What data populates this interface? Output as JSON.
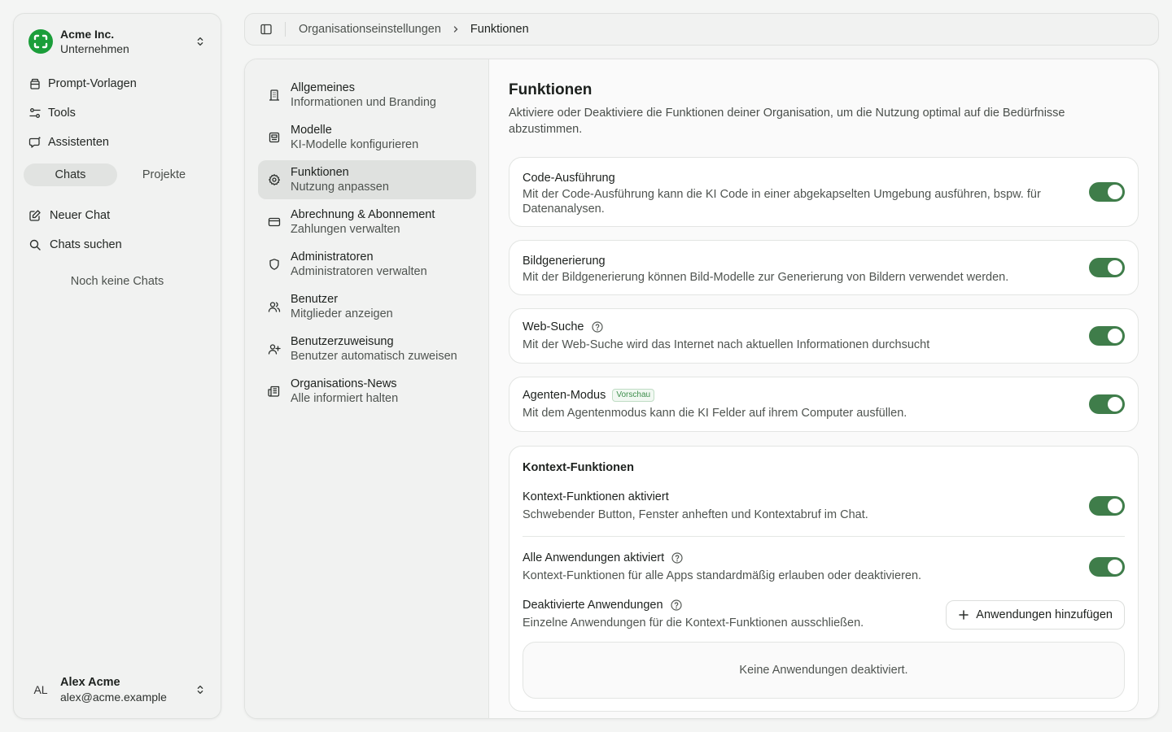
{
  "sidebar": {
    "org": {
      "name": "Acme Inc.",
      "subtitle": "Unternehmen"
    },
    "nav": [
      {
        "label": "Prompt-Vorlagen",
        "icon": "prompt-template-icon"
      },
      {
        "label": "Tools",
        "icon": "tools-icon"
      },
      {
        "label": "Assistenten",
        "icon": "assistant-icon"
      }
    ],
    "tabs": [
      {
        "label": "Chats",
        "active": true
      },
      {
        "label": "Projekte",
        "active": false
      }
    ],
    "actions": [
      {
        "label": "Neuer Chat",
        "icon": "edit-icon"
      },
      {
        "label": "Chats suchen",
        "icon": "search-icon"
      }
    ],
    "empty_text": "Noch keine Chats",
    "user": {
      "initials": "AL",
      "name": "Alex Acme",
      "email": "alex@acme.example"
    }
  },
  "breadcrumb": {
    "parent": "Organisationseinstellungen",
    "current": "Funktionen"
  },
  "settings_nav": [
    {
      "title": "Allgemeines",
      "subtitle": "Informationen und Branding",
      "icon": "building-icon"
    },
    {
      "title": "Modelle",
      "subtitle": "KI-Modelle konfigurieren",
      "icon": "model-icon"
    },
    {
      "title": "Funktionen",
      "subtitle": "Nutzung anpassen",
      "icon": "gear-icon",
      "active": true
    },
    {
      "title": "Abrechnung & Abonnement",
      "subtitle": "Zahlungen verwalten",
      "icon": "credit-card-icon"
    },
    {
      "title": "Administratoren",
      "subtitle": "Administratoren verwalten",
      "icon": "shield-icon"
    },
    {
      "title": "Benutzer",
      "subtitle": "Mitglieder anzeigen",
      "icon": "users-icon"
    },
    {
      "title": "Benutzerzuweisung",
      "subtitle": "Benutzer automatisch zuweisen",
      "icon": "user-plus-icon"
    },
    {
      "title": "Organisations-News",
      "subtitle": "Alle informiert halten",
      "icon": "newspaper-icon"
    }
  ],
  "page": {
    "title": "Funktionen",
    "description": "Aktiviere oder Deaktiviere die Funktionen deiner Organisation, um die Nutzung optimal auf die Bedürfnisse abzustimmen."
  },
  "features": [
    {
      "title": "Code-Ausführung",
      "description": "Mit der Code-Ausführung kann die KI Code in einer abgekapselten Umgebung ausführen, bspw. für Datenanalysen.",
      "enabled": true
    },
    {
      "title": "Bildgenerierung",
      "description": "Mit der Bildgenerierung können Bild-Modelle zur Generierung von Bildern verwendet werden.",
      "enabled": true
    },
    {
      "title": "Web-Suche",
      "description": "Mit der Web-Suche wird das Internet nach aktuellen Informationen durchsucht",
      "enabled": true,
      "help": true
    },
    {
      "title": "Agenten-Modus",
      "badge": "Vorschau",
      "description": "Mit dem Agentenmodus kann die KI Felder auf ihrem Computer ausfüllen.",
      "enabled": true
    }
  ],
  "context": {
    "section_title": "Kontext-Funktionen",
    "enabled_item": {
      "title": "Kontext-Funktionen aktiviert",
      "description": "Schwebender Button, Fenster anheften und Kontextabruf im Chat.",
      "enabled": true
    },
    "all_apps": {
      "title": "Alle Anwendungen aktiviert",
      "description": "Kontext-Funktionen für alle Apps standardmäßig erlauben oder deaktivieren.",
      "enabled": true
    },
    "disabled_apps": {
      "title": "Deaktivierte Anwendungen",
      "description": "Einzelne Anwendungen für die Kontext-Funktionen ausschließen.",
      "add_button": "Anwendungen hinzufügen",
      "empty": "Keine Anwendungen deaktiviert."
    }
  },
  "colors": {
    "toggle_on": "#3f7d4a",
    "logo": "#1b9e3a"
  }
}
